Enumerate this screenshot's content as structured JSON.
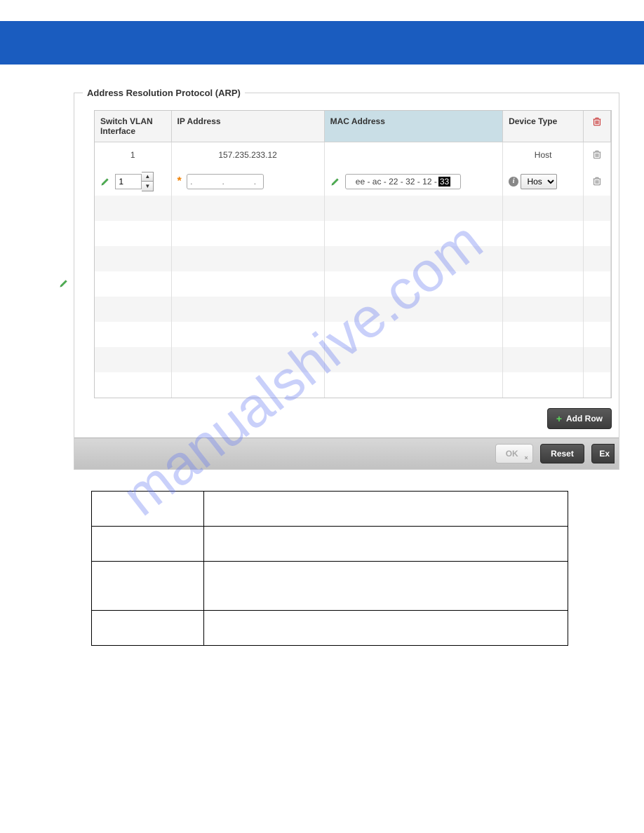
{
  "panel": {
    "title": "Address Resolution Protocol (ARP)"
  },
  "columns": {
    "vlan": "Switch VLAN Interface",
    "ip": "IP Address",
    "mac": "MAC Address",
    "device": "Device Type"
  },
  "rows": [
    {
      "vlan": "1",
      "ip": "157.235.233.12",
      "mac": "",
      "device": "Host"
    }
  ],
  "editRow": {
    "vlan": "1",
    "ipPlaceholder": ".   .   .",
    "macPrefix": "ee - ac -  22 - 32 - 12 - ",
    "macLast": "33",
    "device": "Host"
  },
  "buttons": {
    "addRow": "Add Row",
    "ok": "OK",
    "reset": "Reset",
    "extra": "Ex"
  },
  "watermark": "manualshive.com"
}
